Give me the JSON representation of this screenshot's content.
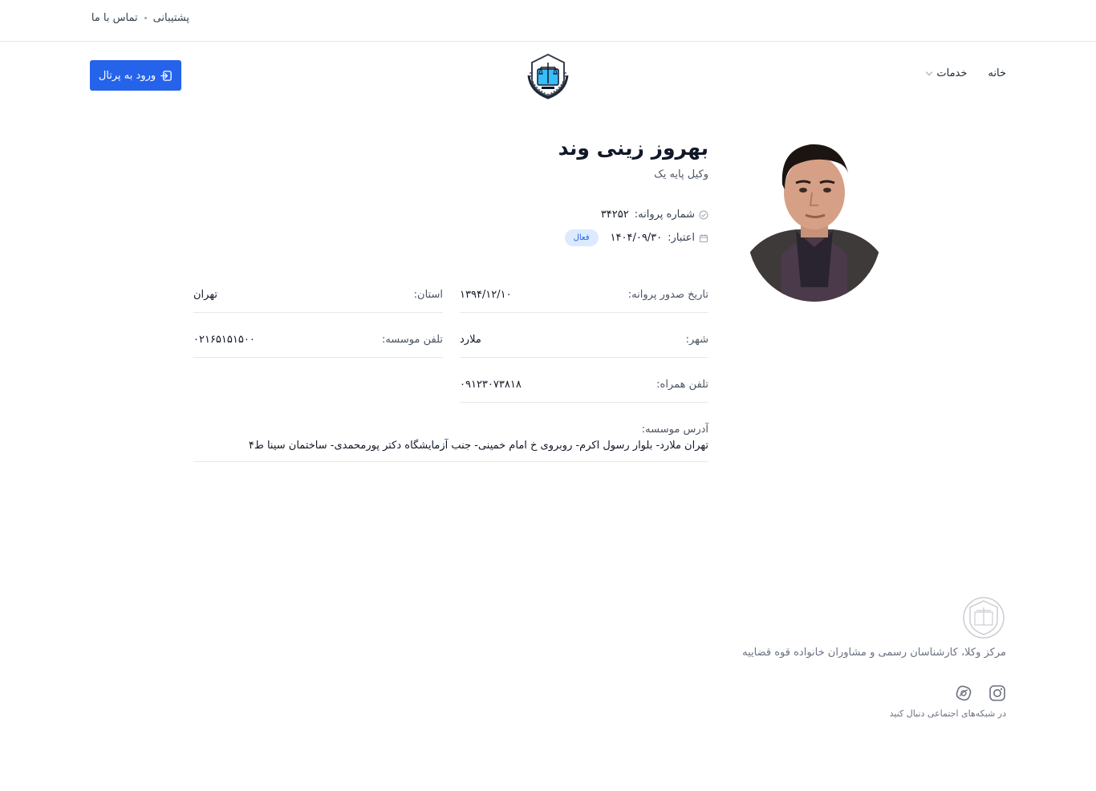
{
  "topbar": {
    "support": "پشتیبانی",
    "contact": "تماس با ما"
  },
  "nav": {
    "home": "خانه",
    "services": "خدمات"
  },
  "login_button": "ورود به پرتال",
  "profile": {
    "name": "بهروز زینی وند",
    "title": "وکیل پایه یک",
    "license_label": "شماره پروانه:",
    "license_number": "۳۴۲۵۲",
    "validity_label": "اعتبار:",
    "validity_date": "۱۴۰۴/۰۹/۳۰",
    "status_badge": "فعال"
  },
  "fields": {
    "issue_date_label": "تاریخ صدور پروانه:",
    "issue_date": "۱۳۹۴/۱۲/۱۰",
    "province_label": "استان:",
    "province": "تهران",
    "city_label": "شهر:",
    "city": "ملارد",
    "office_phone_label": "تلفن موسسه:",
    "office_phone": "۰۲۱۶۵۱۵۱۵۰۰",
    "mobile_label": "تلفن همراه:",
    "mobile": "۰۹۱۲۳۰۷۳۸۱۸",
    "address_label": "آدرس موسسه:",
    "address": "تهران ملارد- بلوار رسول اکرم- روبروی خ امام خمینی- جنب آزمایشگاه دکتر پورمحمدی- ساختمان سینا ط۴"
  },
  "footer": {
    "title": "مرکز وکلا، کارشناسان رسمی و مشاوران خانواده قوه قضاییه",
    "follow": "در شبکه‌های اجتماعی دنبال کنید"
  },
  "colors": {
    "primary": "#2563eb",
    "badge_bg": "#dbeafe",
    "border": "#e5e7eb"
  }
}
